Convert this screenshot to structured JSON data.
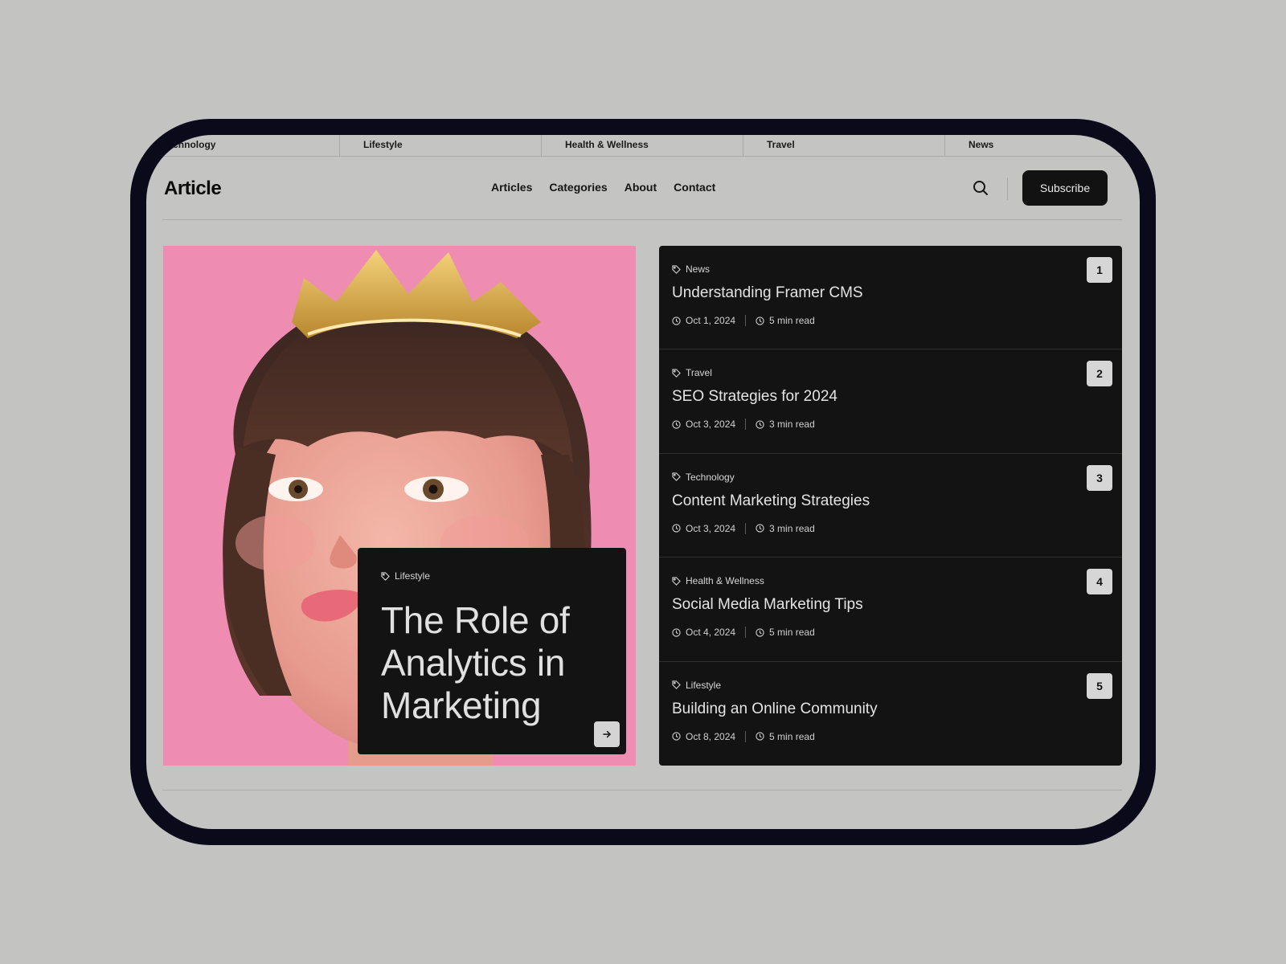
{
  "ticker": [
    "Technology",
    "Lifestyle",
    "Health & Wellness",
    "Travel",
    "News"
  ],
  "header": {
    "logo": "Article",
    "nav": [
      "Articles",
      "Categories",
      "About",
      "Contact"
    ],
    "subscribe_label": "Subscribe"
  },
  "featured": {
    "tag": "Lifestyle",
    "title": "The Role of Analytics in Marketing"
  },
  "articles": [
    {
      "rank": "1",
      "tag": "News",
      "title": "Understanding Framer CMS",
      "date": "Oct 1, 2024",
      "read": "5  min read"
    },
    {
      "rank": "2",
      "tag": "Travel",
      "title": "SEO Strategies for 2024",
      "date": "Oct 3, 2024",
      "read": "3 min read"
    },
    {
      "rank": "3",
      "tag": "Technology",
      "title": "Content Marketing Strategies",
      "date": "Oct 3, 2024",
      "read": "3 min read"
    },
    {
      "rank": "4",
      "tag": "Health & Wellness",
      "title": "Social Media Marketing Tips",
      "date": "Oct 4, 2024",
      "read": "5 min read"
    },
    {
      "rank": "5",
      "tag": "Lifestyle",
      "title": "Building an Online Community",
      "date": "Oct 8, 2024",
      "read": "5 min read"
    }
  ],
  "colors": {
    "background": "#c4c4c2",
    "dark": "#131313",
    "device_frame": "#0b0a1a",
    "hero_pink": "#ee8cb2"
  }
}
